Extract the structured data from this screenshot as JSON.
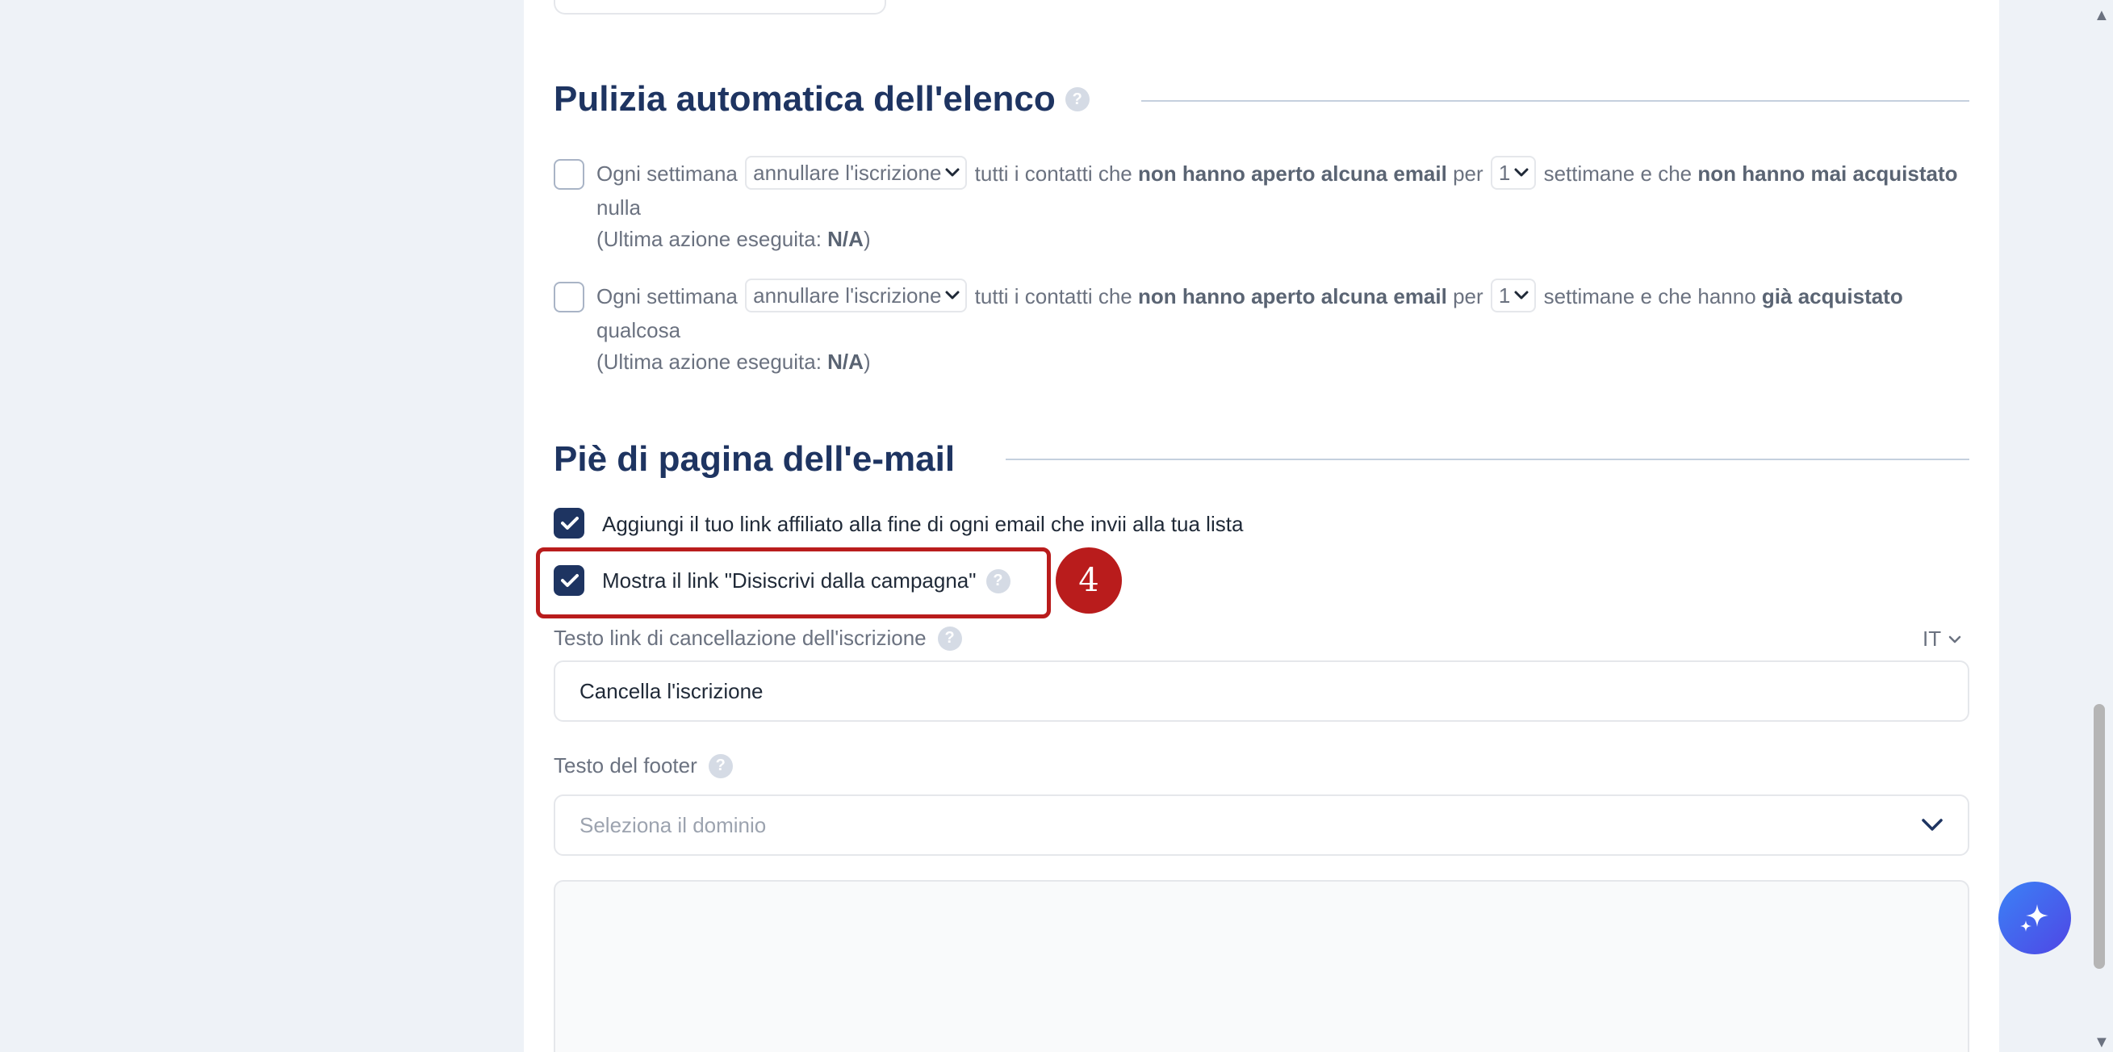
{
  "list_cleaning": {
    "title": "Pulizia automatica dell'elenco",
    "help_glyph": "?",
    "rules": [
      {
        "checked": false,
        "text_prefix": "Ogni settimana",
        "action_value": "annullare l'iscrizione",
        "text_contacts": "tutti i contatti che",
        "condition_opened": "non hanno aperto alcuna email",
        "text_for": "per",
        "weeks_value": "1",
        "text_weeks": "settimane e che",
        "purchase_condition": "non hanno mai acquistato",
        "purchase_suffix": "nulla",
        "last_action_label": "(Ultima azione eseguita:",
        "last_action_value": "N/A",
        "last_action_close": ")"
      },
      {
        "checked": false,
        "text_prefix": "Ogni settimana",
        "action_value": "annullare l'iscrizione",
        "text_contacts": "tutti i contatti che",
        "condition_opened": "non hanno aperto alcuna email",
        "text_for": "per",
        "weeks_value": "1",
        "text_weeks": "settimane e che hanno",
        "purchase_condition": "già acquistato",
        "purchase_suffix": "qualcosa",
        "last_action_label": "(Ultima azione eseguita:",
        "last_action_value": "N/A",
        "last_action_close": ")"
      }
    ]
  },
  "email_footer": {
    "title": "Piè di pagina dell'e-mail",
    "affiliate_option": {
      "label": "Aggiungi il tuo link affiliato alla fine di ogni email che invii alla tua lista",
      "checked": true
    },
    "unsubscribe_option": {
      "label": "Mostra il link \"Disiscrivi dalla campagna\"",
      "checked": true
    },
    "step_badge": "4",
    "unsubscribe_text_field": {
      "label": "Testo link di cancellazione dell'iscrizione",
      "language": "IT",
      "value": "Cancella l'iscrizione"
    },
    "footer_text_field": {
      "label": "Testo del footer",
      "placeholder": "Seleziona il dominio"
    }
  },
  "colors": {
    "brand": "#1e3461",
    "highlight": "#b91c1c",
    "fab_gradient_start": "#3b82f6",
    "fab_gradient_end": "#4f46e5"
  },
  "icons": {
    "help": "question-mark-circle",
    "check": "checkmark",
    "dropdown": "chevron-down",
    "assistant": "sparkles",
    "scroll_up": "▲",
    "scroll_down": "▼"
  }
}
